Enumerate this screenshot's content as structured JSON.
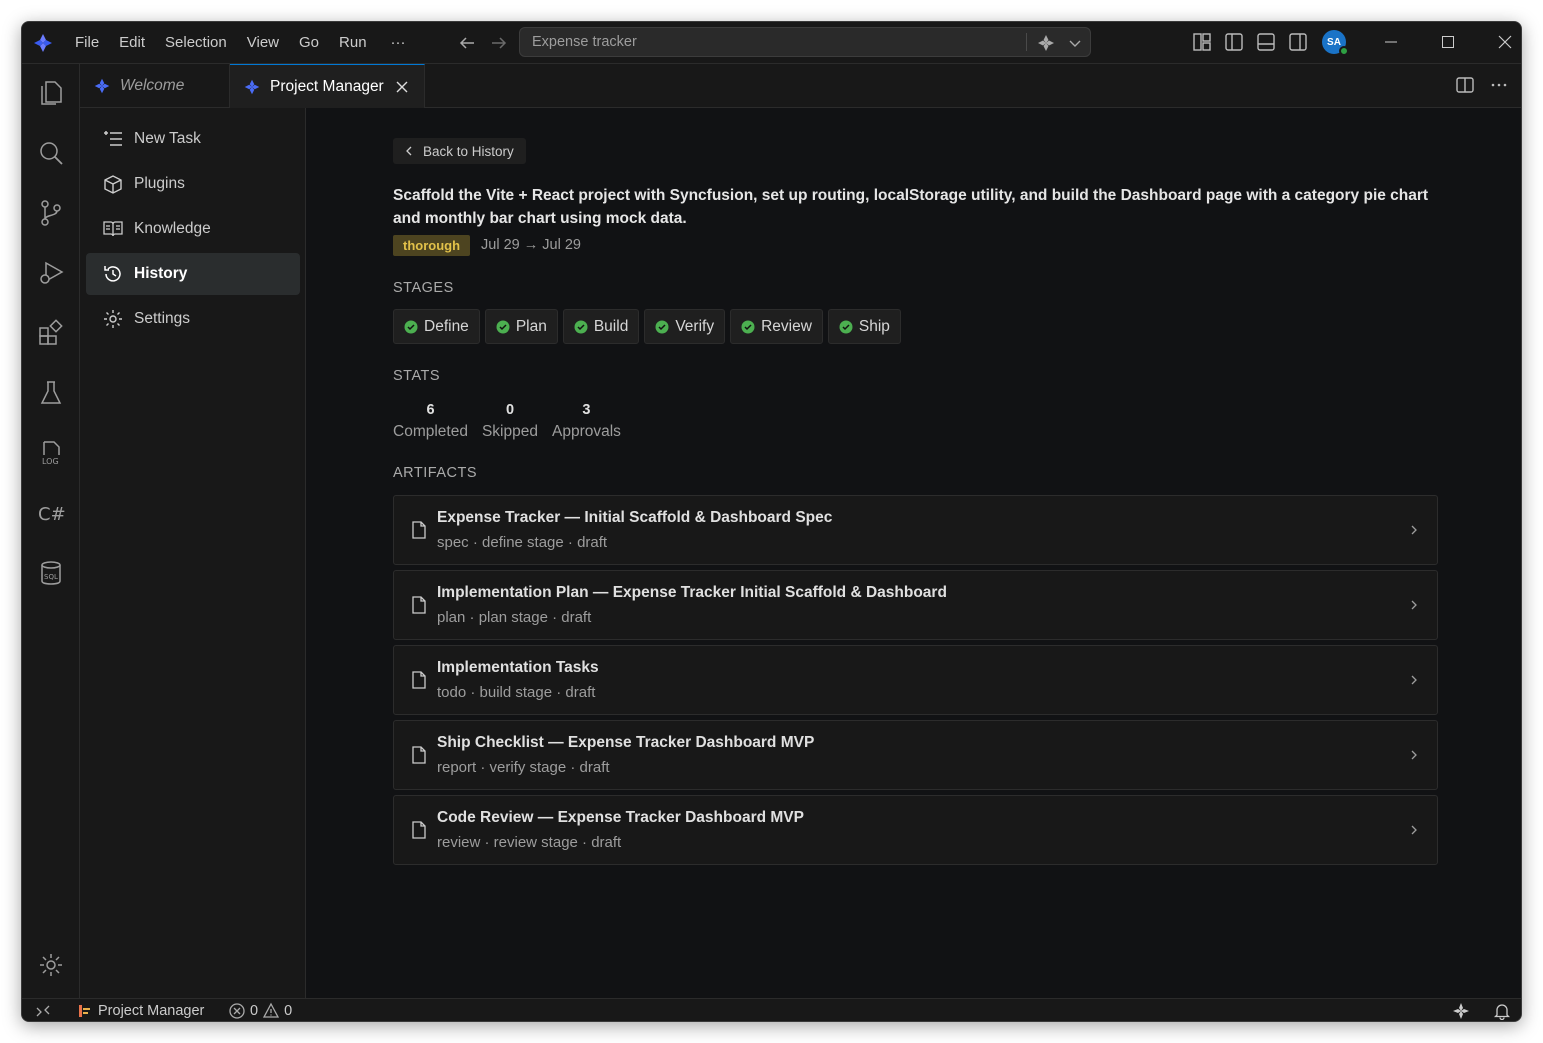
{
  "menu": [
    "File",
    "Edit",
    "Selection",
    "View",
    "Go",
    "Run",
    "···"
  ],
  "command_center": {
    "text": "Expense tracker"
  },
  "avatar": {
    "initials": "SA"
  },
  "tabs": [
    {
      "label": "Welcome"
    },
    {
      "label": "Project Manager"
    }
  ],
  "sidebar": {
    "items": [
      {
        "label": "New Task",
        "icon": "list-add-icon"
      },
      {
        "label": "Plugins",
        "icon": "package-icon"
      },
      {
        "label": "Knowledge",
        "icon": "book-icon"
      },
      {
        "label": "History",
        "icon": "history-icon",
        "active": true
      },
      {
        "label": "Settings",
        "icon": "gear-icon"
      }
    ]
  },
  "main": {
    "back_label": "Back to History",
    "task_title": "Scaffold the Vite + React project with Syncfusion, set up routing, localStorage utility, and build the Dashboard page with a category pie chart and monthly bar chart using mock data.",
    "mode_badge": "thorough",
    "dates": "Jul 29 → Jul 29",
    "stages_heading": "STAGES",
    "stages": [
      {
        "label": "Define"
      },
      {
        "label": "Plan"
      },
      {
        "label": "Build"
      },
      {
        "label": "Verify"
      },
      {
        "label": "Review"
      },
      {
        "label": "Ship"
      }
    ],
    "stats_heading": "STATS",
    "stats": [
      {
        "value": "6",
        "label": "Completed"
      },
      {
        "value": "0",
        "label": "Skipped"
      },
      {
        "value": "3",
        "label": "Approvals"
      }
    ],
    "artifacts_heading": "ARTIFACTS",
    "artifacts": [
      {
        "title": "Expense Tracker — Initial Scaffold & Dashboard Spec",
        "subtitle": "spec · define stage · draft"
      },
      {
        "title": "Implementation Plan — Expense Tracker Initial Scaffold & Dashboard",
        "subtitle": "plan · plan stage · draft"
      },
      {
        "title": "Implementation Tasks",
        "subtitle": "todo · build stage · draft"
      },
      {
        "title": "Ship Checklist — Expense Tracker Dashboard MVP",
        "subtitle": "report · verify stage · draft"
      },
      {
        "title": "Code Review — Expense Tracker Dashboard MVP",
        "subtitle": "review · review stage · draft"
      }
    ]
  },
  "statusbar": {
    "project": "Project Manager",
    "errors": "0",
    "warnings": "0"
  },
  "colors": {
    "accent": "#0078d4",
    "success": "#4caf50",
    "badge_bg": "#4d4420",
    "badge_fg": "#e2c14a",
    "bg": "#111214"
  }
}
